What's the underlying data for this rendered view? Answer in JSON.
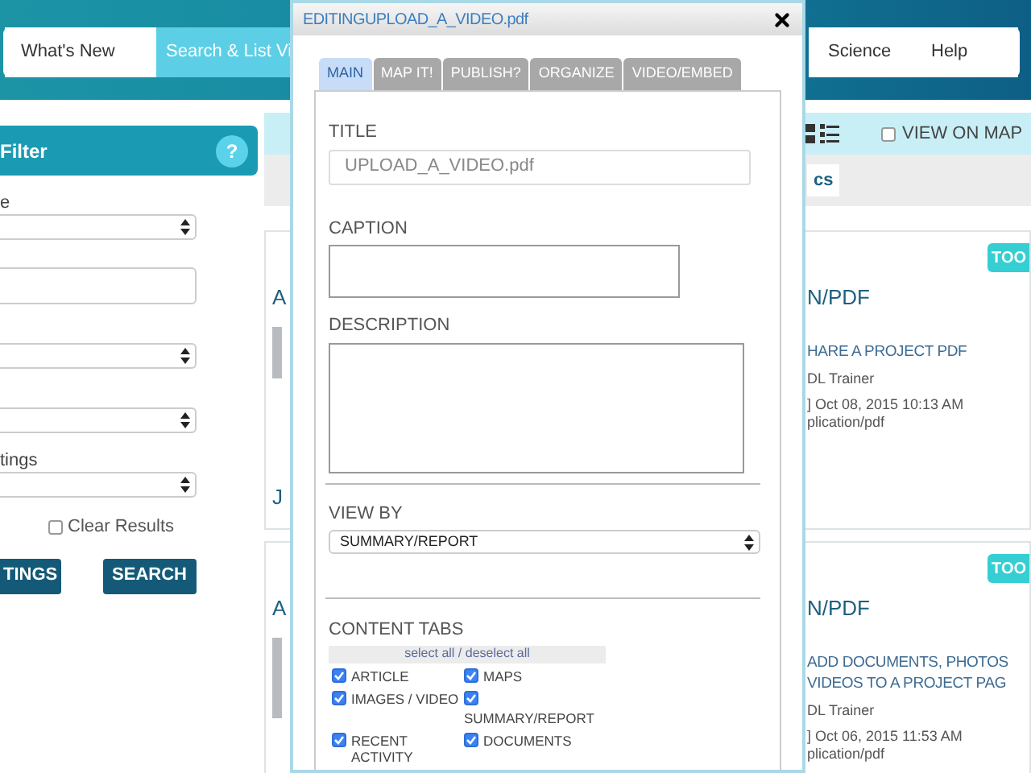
{
  "header": {
    "nav": [
      {
        "label": "What's New",
        "selected": false
      },
      {
        "label": "Search & List Vi",
        "selected": true
      },
      {
        "label": "Science",
        "selected": false
      },
      {
        "label": "Help",
        "selected": false
      }
    ]
  },
  "filter_panel": {
    "title": "Filter",
    "help": "?",
    "fields": [
      {
        "kind": "select",
        "label": "e"
      },
      {
        "kind": "input"
      },
      {
        "kind": "select"
      },
      {
        "kind": "select"
      },
      {
        "kind": "select",
        "label": "tings"
      }
    ],
    "clear_results": {
      "label": "Clear Results",
      "checked": false
    },
    "buttons": [
      "TINGS",
      "SEARCH"
    ]
  },
  "results_toolbar": {
    "view_on_map": {
      "label": "VIEW ON MAP",
      "checked": false
    },
    "tab": "cs"
  },
  "results": [
    {
      "title_start": "A",
      "badge": "TOO",
      "title_end": "N/PDF",
      "name_lines": [
        "HARE A PROJECT PDF"
      ],
      "author": "DL Trainer",
      "date": "] Oct 08, 2015 10:13 AM",
      "type": "plication/pdf",
      "footer": "J"
    },
    {
      "title_start": "A",
      "badge": "TOO",
      "title_end": "N/PDF",
      "name_lines": [
        "ADD DOCUMENTS, PHOTOS",
        "VIDEOS TO A PROJECT PAG"
      ],
      "author": "DL Trainer",
      "date": "] Oct 06, 2015 11:53 AM",
      "type": "plication/pdf"
    }
  ],
  "dialog": {
    "title": "EDITINGUPLOAD_A_VIDEO.pdf",
    "tabs": [
      {
        "label": "MAIN",
        "selected": true
      },
      {
        "label": "MAP IT!",
        "selected": false
      },
      {
        "label": "PUBLISH?",
        "selected": false
      },
      {
        "label": "ORGANIZE",
        "selected": false
      },
      {
        "label": "VIDEO/EMBED",
        "selected": false
      }
    ],
    "title_label": "TITLE",
    "title_value": "UPLOAD_A_VIDEO.pdf",
    "caption_label": "CAPTION",
    "description_label": "DESCRIPTION",
    "view_by_label": "VIEW BY",
    "view_by_value": "SUMMARY/REPORT",
    "content_tabs_label": "CONTENT TABS",
    "select_all": "select all / deselect all",
    "content_tabs": [
      {
        "label": "ARTICLE",
        "checked": true
      },
      {
        "label": "MAPS",
        "checked": true
      },
      {
        "label": "IMAGES / VIDEO",
        "checked": true
      },
      {
        "label": "SUMMARY/REPORT",
        "checked": true
      },
      {
        "label": "RECENT ACTIVITY",
        "checked": true
      },
      {
        "label": "DOCUMENTS",
        "checked": true
      }
    ]
  }
}
